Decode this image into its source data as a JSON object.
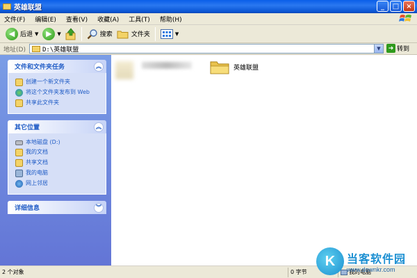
{
  "window": {
    "title": "英雄联盟",
    "minimize_label": "_",
    "maximize_label": "□",
    "close_label": "×"
  },
  "menu": {
    "items": [
      "文件(F)",
      "编辑(E)",
      "查看(V)",
      "收藏(A)",
      "工具(T)",
      "帮助(H)"
    ]
  },
  "toolbar": {
    "back_label": "后退",
    "search_label": "搜索",
    "folders_label": "文件夹"
  },
  "address": {
    "label": "地址(D)",
    "value": "D:\\英雄联盟",
    "go_label": "转到"
  },
  "taskpane": {
    "file_tasks": {
      "title": "文件和文件夹任务",
      "items": [
        "创建一个新文件夹",
        "将这个文件夹发布到 Web",
        "共享此文件夹"
      ]
    },
    "other_places": {
      "title": "其它位置",
      "items": [
        "本地磁盘 (D:)",
        "我的文档",
        "共享文档",
        "我的电脑",
        "网上邻居"
      ]
    },
    "details": {
      "title": "详细信息"
    }
  },
  "content": {
    "folder_name": "英雄联盟"
  },
  "statusbar": {
    "object_count": "2 个对象",
    "size": "0 字节",
    "location": "我的电脑"
  },
  "watermark": {
    "title": "当客软件园",
    "url": "www.downkr.com"
  },
  "colors": {
    "titlebar": "#0a5ee8",
    "taskpane": "#6f8ee0",
    "link_blue": "#215dc6"
  }
}
